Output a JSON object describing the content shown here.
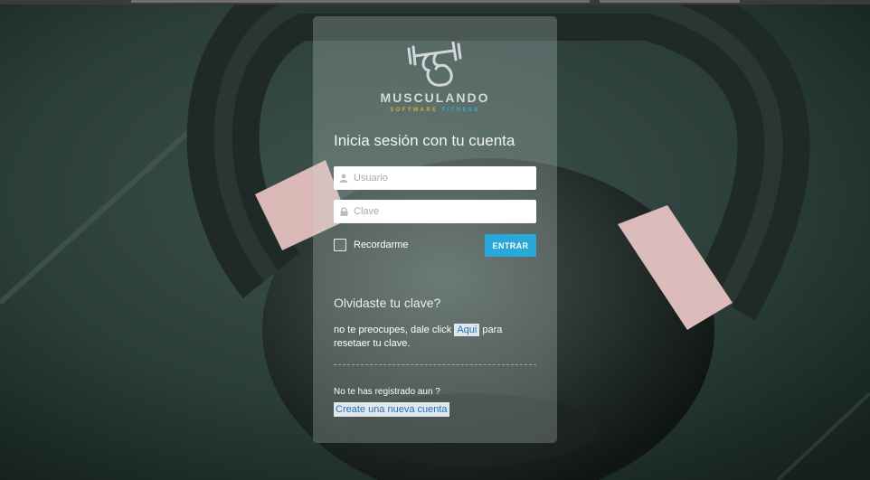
{
  "brand": {
    "name": "MUSCULANDO",
    "tagline_part1": "SOFTWARE",
    "tagline_part2": "FITNESS",
    "logo_icon": "dumbbell-bicep-icon",
    "accent_orange": "#e8a63a",
    "accent_blue": "#39a9d8"
  },
  "login": {
    "title": "Inicia sesión con tu cuenta",
    "username_placeholder": "Usuario",
    "username_value": "",
    "username_icon": "user-icon",
    "password_placeholder": "Clave",
    "password_value": "",
    "password_icon": "lock-icon",
    "remember_label": "Recordarme",
    "remember_checked": false,
    "submit_label": "ENTRAR",
    "submit_color": "#29a8d9"
  },
  "forgot": {
    "title": "Olvidaste tu clave?",
    "text_before": "no te preocupes, dale click ",
    "link_label": "Aqui",
    "text_after": " para resetaer tu clave."
  },
  "register": {
    "question": "No te has registrado aun ?",
    "link_label": "Create una nueva cuenta"
  },
  "background": {
    "subject": "kettlebell-photo"
  }
}
